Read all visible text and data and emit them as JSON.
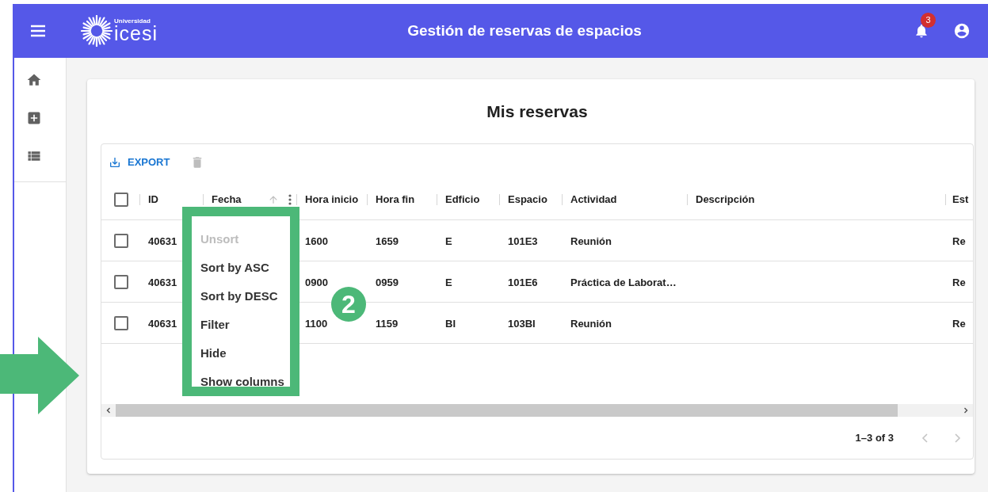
{
  "app_bar": {
    "logo_caption": "Universidad",
    "logo_text": "icesi",
    "title": "Gestión de reservas de espacios",
    "notification_count": "3"
  },
  "page": {
    "title": "Mis reservas"
  },
  "toolbar": {
    "export": "EXPORT"
  },
  "table": {
    "all_selected": false,
    "columns": [
      {
        "label": "ID",
        "sortable": false
      },
      {
        "label": "Fecha",
        "sortable": true
      },
      {
        "label": "Hora inicio",
        "sortable": false
      },
      {
        "label": "Hora fin",
        "sortable": false
      },
      {
        "label": "Edficio",
        "sortable": false
      },
      {
        "label": "Espacio",
        "sortable": false
      },
      {
        "label": "Actividad",
        "sortable": false
      },
      {
        "label": "Descripción",
        "sortable": false
      },
      {
        "label": "Est",
        "sortable": false
      }
    ],
    "rows": [
      {
        "selected": false,
        "cells": [
          "40631",
          null,
          "1600",
          "1659",
          "E",
          "101E3",
          "Reunión",
          null,
          "Re"
        ]
      },
      {
        "selected": false,
        "cells": [
          "40631",
          null,
          "0900",
          "0959",
          "E",
          "101E6",
          "Práctica de Laborat…",
          null,
          "Re"
        ]
      },
      {
        "selected": false,
        "cells": [
          "40631",
          null,
          "1100",
          "1159",
          "BI",
          "103BI",
          "Reunión",
          null,
          "Re"
        ]
      }
    ]
  },
  "footer": {
    "range": "1–3 of 3"
  },
  "column_menu": {
    "items": [
      {
        "label": "Unsort",
        "disabled": true
      },
      {
        "label": "Sort by ASC",
        "disabled": false
      },
      {
        "label": "Sort by DESC",
        "disabled": false
      },
      {
        "label": "Filter",
        "disabled": false
      },
      {
        "label": "Hide",
        "disabled": false
      },
      {
        "label": "Show columns",
        "disabled": false
      }
    ]
  },
  "annotation": {
    "step": "2"
  }
}
